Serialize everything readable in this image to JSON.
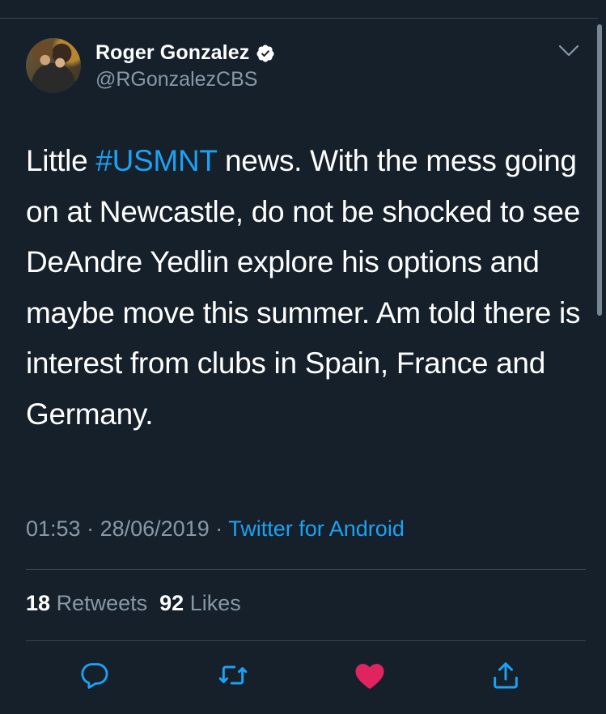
{
  "author": {
    "display_name": "Roger Gonzalez",
    "handle": "@RGonzalezCBS",
    "verified": true
  },
  "tweet": {
    "text_before": "Little ",
    "hashtag": "#USMNT",
    "text_after": " news. With the mess going on at Newcastle, do not be shocked to see DeAndre Yedlin explore his options and maybe move this summer. Am told there is interest from clubs in Spain, France and Germany."
  },
  "meta": {
    "time": "01:53",
    "sep1": " · ",
    "date": "28/06/2019",
    "sep2": " · ",
    "source": "Twitter for Android"
  },
  "stats": {
    "retweets_count": "18",
    "retweets_label": "Retweets",
    "likes_count": "92",
    "likes_label": "Likes"
  },
  "colors": {
    "background": "#15202b",
    "accent": "#1da1f2",
    "secondary_text": "#8899a6",
    "like": "#e0245e"
  },
  "icons": [
    "verified-badge-icon",
    "chevron-down-icon",
    "reply-icon",
    "retweet-icon",
    "like-icon",
    "share-icon"
  ]
}
